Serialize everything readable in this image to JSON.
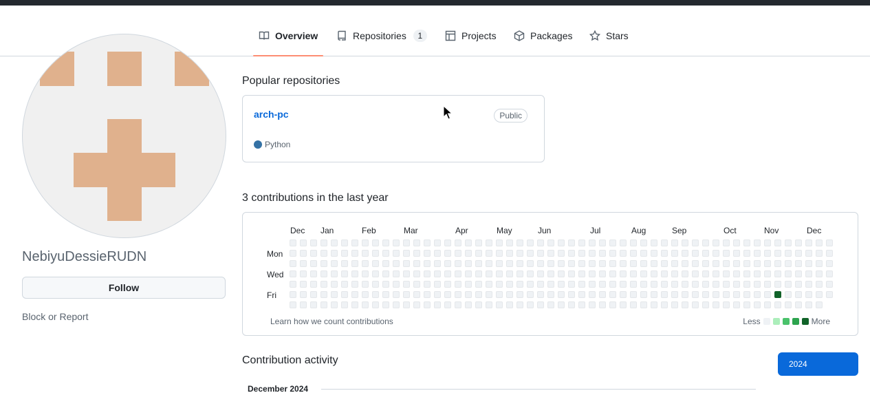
{
  "nav": {
    "tabs": [
      {
        "label": "Overview",
        "icon": "book-icon",
        "selected": true
      },
      {
        "label": "Repositories",
        "icon": "repo-icon",
        "count": "1"
      },
      {
        "label": "Projects",
        "icon": "table-icon"
      },
      {
        "label": "Packages",
        "icon": "package-icon"
      },
      {
        "label": "Stars",
        "icon": "star-icon"
      }
    ]
  },
  "profile": {
    "username": "NebiyuDessieRUDN",
    "follow_label": "Follow",
    "block_label": "Block or Report",
    "avatar_color": "#e0b18d"
  },
  "popular": {
    "title": "Popular repositories",
    "repos": [
      {
        "name": "arch-pc",
        "visibility": "Public",
        "language": "Python",
        "language_color": "#3572a5"
      }
    ]
  },
  "contributions": {
    "title": "3 contributions in the last year",
    "months": [
      "Dec",
      "Jan",
      "Feb",
      "Mar",
      "Apr",
      "May",
      "Jun",
      "Jul",
      "Aug",
      "Sep",
      "Oct",
      "Nov",
      "Dec"
    ],
    "days": [
      "Mon",
      "Wed",
      "Fri"
    ],
    "learn_label": "Learn how we count contributions",
    "legend_less": "Less",
    "legend_more": "More",
    "legend_colors": [
      "#eff2f5",
      "#aceebb",
      "#4ac26b",
      "#2da44e",
      "#116329"
    ],
    "active_day": {
      "week": 47,
      "weekday": 5,
      "level": 4
    }
  },
  "activity": {
    "title": "Contribution activity",
    "year": "2024",
    "month_header": "December 2024"
  }
}
